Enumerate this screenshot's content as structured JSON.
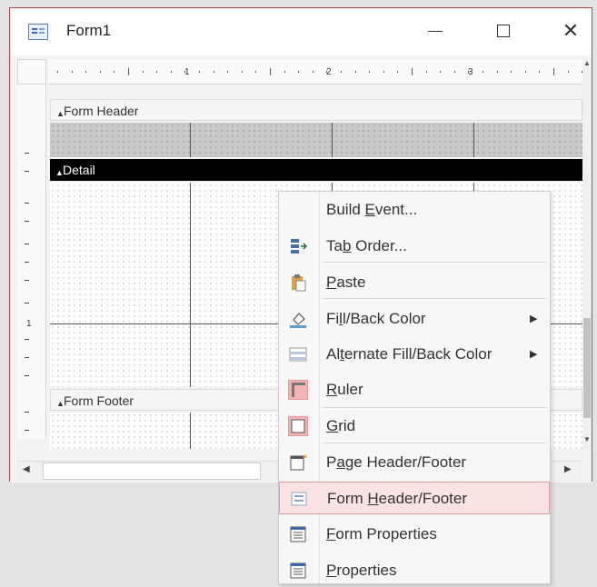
{
  "window": {
    "title": "Form1"
  },
  "ruler": {
    "marks": [
      "1",
      "2",
      "3"
    ]
  },
  "vertical_ruler": {
    "mark": "1"
  },
  "sections": {
    "form_header": "Form Header",
    "detail": "Detail",
    "form_footer": "Form Footer"
  },
  "context_menu": {
    "items": [
      {
        "pre": "Build ",
        "u": "E",
        "post": "vent...",
        "icon": "none"
      },
      {
        "pre": "Ta",
        "u": "b",
        "post": " Order...",
        "icon": "tab-order-icon"
      },
      {
        "pre": "",
        "u": "P",
        "post": "aste",
        "icon": "paste-icon"
      },
      {
        "pre": "Fi",
        "u": "l",
        "post": "l/Back Color",
        "icon": "fill-color-icon",
        "submenu": true
      },
      {
        "pre": "Al",
        "u": "t",
        "post": "ernate Fill/Back Color",
        "icon": "alternate-fill-icon",
        "submenu": true
      },
      {
        "pre": "",
        "u": "R",
        "post": "uler",
        "icon": "ruler-icon"
      },
      {
        "pre": "",
        "u": "G",
        "post": "rid",
        "icon": "grid-icon"
      },
      {
        "pre": "P",
        "u": "a",
        "post": "ge Header/Footer",
        "icon": "page-header-footer-icon"
      },
      {
        "pre": "Form ",
        "u": "H",
        "post": "eader/Footer",
        "icon": "form-header-footer-icon",
        "highlighted": true
      },
      {
        "pre": "",
        "u": "F",
        "post": "orm Properties",
        "icon": "form-properties-icon"
      },
      {
        "pre": "",
        "u": "P",
        "post": "roperties",
        "icon": "properties-icon"
      }
    ]
  },
  "colors": {
    "window_border": "#b04a4a",
    "highlight_bg": "#fbe3e3",
    "highlight_border": "#e29b9b",
    "detail_bar": "#000000"
  }
}
